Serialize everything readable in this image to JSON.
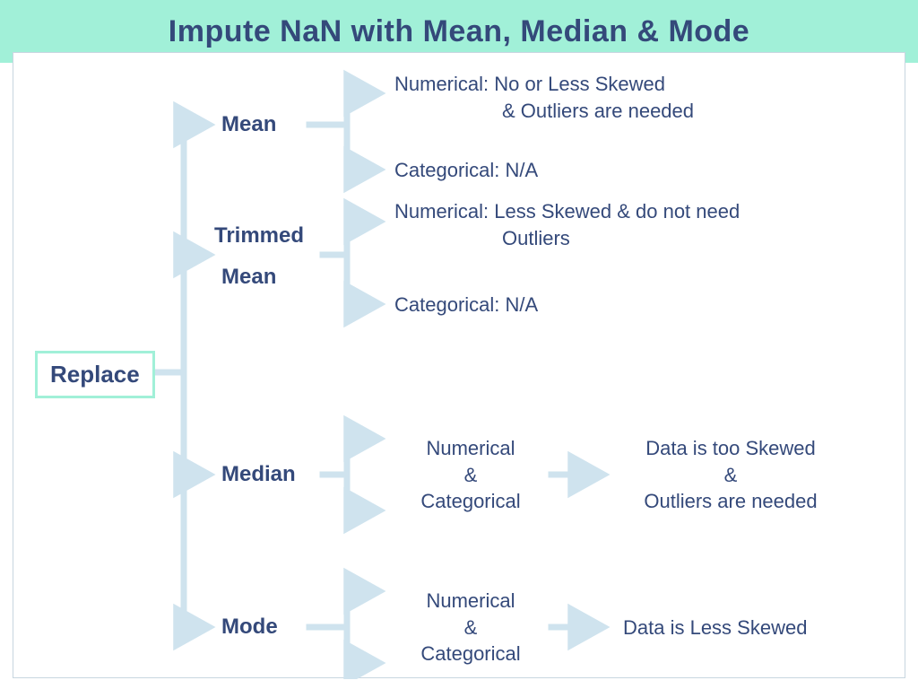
{
  "title": "Impute NaN with Mean, Median & Mode",
  "root": "Replace",
  "methods": {
    "mean": {
      "label": "Mean",
      "numerical_line1": "Numerical: No or Less Skewed",
      "numerical_line2": "& Outliers are needed",
      "categorical": "Categorical: N/A"
    },
    "trimmed": {
      "label_line1": "Trimmed",
      "label_line2": "Mean",
      "numerical_line1": "Numerical: Less Skewed & do not need",
      "numerical_line2": "Outliers",
      "categorical": "Categorical: N/A"
    },
    "median": {
      "label": "Median",
      "types_line1": "Numerical",
      "types_line2": "&",
      "types_line3": "Categorical",
      "cond_line1": "Data is too Skewed",
      "cond_line2": "&",
      "cond_line3": "Outliers are needed"
    },
    "mode": {
      "label": "Mode",
      "types_line1": "Numerical",
      "types_line2": "&",
      "types_line3": "Categorical",
      "cond": "Data is Less Skewed"
    }
  },
  "colors": {
    "header_bg": "#a1f0d8",
    "text": "#34497a",
    "line": "#cfe3ee"
  }
}
